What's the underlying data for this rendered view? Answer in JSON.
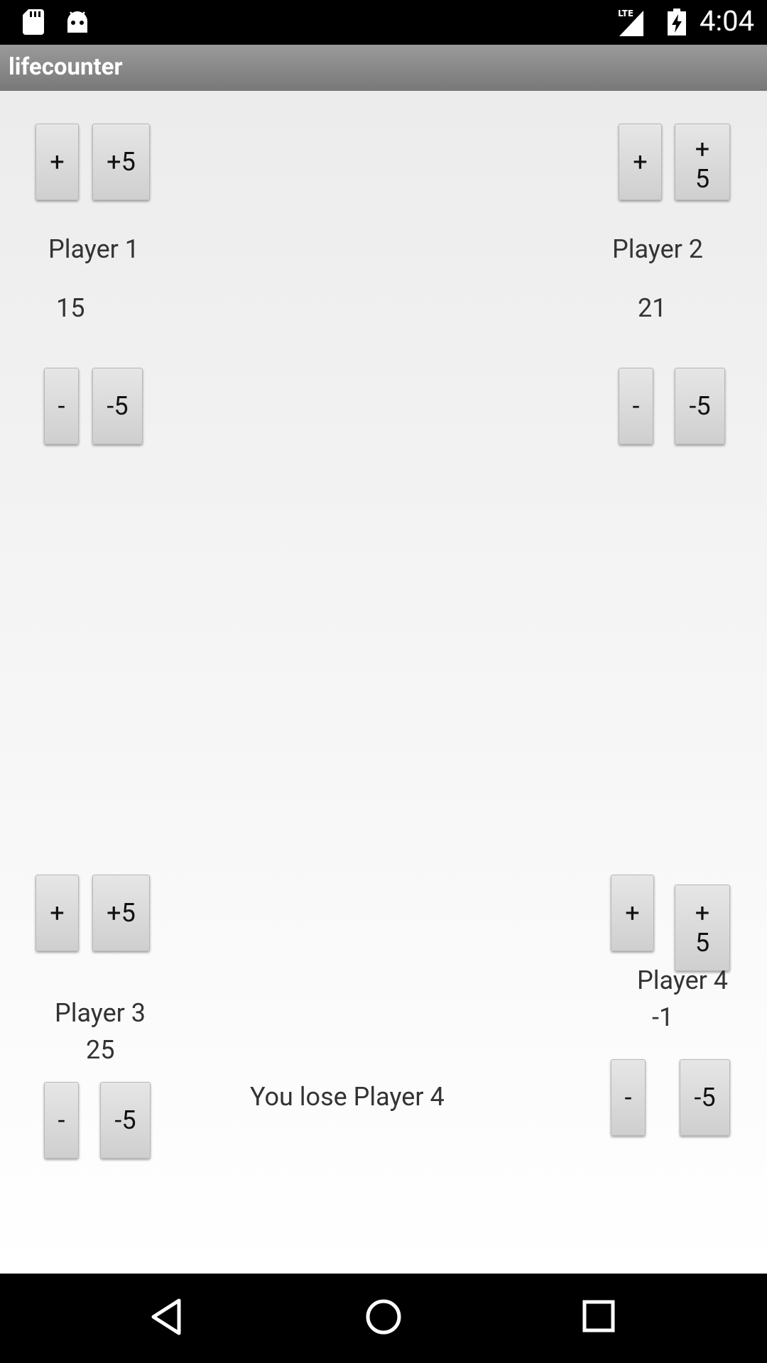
{
  "status_bar": {
    "time": "4:04",
    "network": "LTE"
  },
  "app": {
    "title": "lifecounter"
  },
  "players": [
    {
      "name": "Player 1",
      "life": "15",
      "plus": "+",
      "plus5": "+5",
      "minus": "-",
      "minus5": "-5"
    },
    {
      "name": "Player 2",
      "life": "21",
      "plus": "+",
      "plus5": "+5",
      "minus": "-",
      "minus5": "-5"
    },
    {
      "name": "Player 3",
      "life": "25",
      "plus": "+",
      "plus5": "+5",
      "minus": "-",
      "minus5": "-5"
    },
    {
      "name": "Player 4",
      "life": "-1",
      "plus": "+",
      "plus5": "+5",
      "minus": "-",
      "minus5": "-5"
    }
  ],
  "message": "You lose Player 4",
  "nav": {
    "back_icon": "back-triangle",
    "home_icon": "home-circle",
    "recents_icon": "recents-square"
  }
}
